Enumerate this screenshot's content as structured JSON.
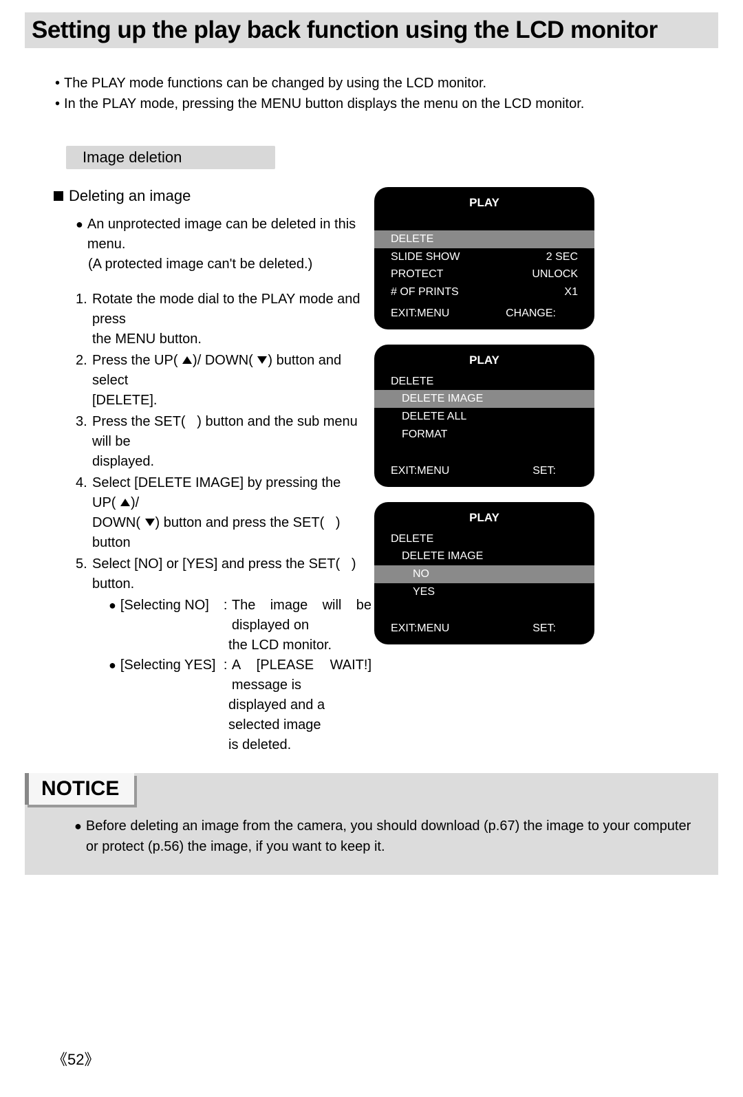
{
  "title": "Setting up the play back function using the LCD monitor",
  "intro": [
    "The PLAY mode functions can be changed by using the LCD monitor.",
    "In the PLAY mode, pressing the MENU button displays the menu on the LCD monitor."
  ],
  "section_label": "Image deletion",
  "subheading": "Deleting an image",
  "subpoint_lines": [
    "An unprotected image can be deleted in this menu.",
    "(A protected image can't be deleted.)"
  ],
  "steps": {
    "s1_a": "Rotate the mode dial to the PLAY mode and press",
    "s1_b": "the MENU button.",
    "s2_a": "Press the UP(",
    "s2_b": ")/ DOWN(",
    "s2_c": ") button and select",
    "s2_d": "[DELETE].",
    "s3_a": "Press the SET(",
    "s3_b": ") button and the sub menu will be",
    "s3_c": "displayed.",
    "s4_a": "Select [DELETE IMAGE] by pressing the UP(",
    "s4_b": ")/",
    "s4_c": "DOWN(",
    "s4_d": ") button and press the SET(",
    "s4_e": ") button",
    "s5_a": "Select [NO] or [YES] and press the SET(",
    "s5_b": ") button."
  },
  "selecting": {
    "no_label": "[Selecting NO]",
    "no_text1": "The image will be displayed on",
    "no_text2": "the LCD monitor.",
    "yes_label": "[Selecting YES]",
    "yes_text1": "A [PLEASE WAIT!] message is",
    "yes_text2": "displayed and a selected image",
    "yes_text3": "is deleted."
  },
  "lcd1": {
    "title": "PLAY",
    "rows": [
      {
        "l": "DELETE",
        "r": "",
        "hl": true,
        "indent": 0
      },
      {
        "l": "SLIDE SHOW",
        "r": "2 SEC",
        "hl": false,
        "indent": 0
      },
      {
        "l": "PROTECT",
        "r": "UNLOCK",
        "hl": false,
        "indent": 0
      },
      {
        "l": "# OF PRINTS",
        "r": "X1",
        "hl": false,
        "indent": 0
      }
    ],
    "footer_l": "EXIT:MENU",
    "footer_r": "CHANGE:"
  },
  "lcd2": {
    "title": "PLAY",
    "header": "DELETE",
    "rows": [
      {
        "l": "DELETE IMAGE",
        "hl": true,
        "indent": 1
      },
      {
        "l": "DELETE ALL",
        "hl": false,
        "indent": 1
      },
      {
        "l": "FORMAT",
        "hl": false,
        "indent": 1
      }
    ],
    "footer_l": "EXIT:MENU",
    "footer_r": "SET:"
  },
  "lcd3": {
    "title": "PLAY",
    "header": "DELETE",
    "sub": "DELETE IMAGE",
    "rows": [
      {
        "l": "NO",
        "hl": true,
        "indent": 2
      },
      {
        "l": "YES",
        "hl": false,
        "indent": 2
      }
    ],
    "footer_l": "EXIT:MENU",
    "footer_r": "SET:"
  },
  "notice_label": "NOTICE",
  "notice_text": "Before deleting an image from the camera, you should download (p.67) the image to your computer or protect (p.56) the image, if you want to keep it.",
  "page_number": "52"
}
